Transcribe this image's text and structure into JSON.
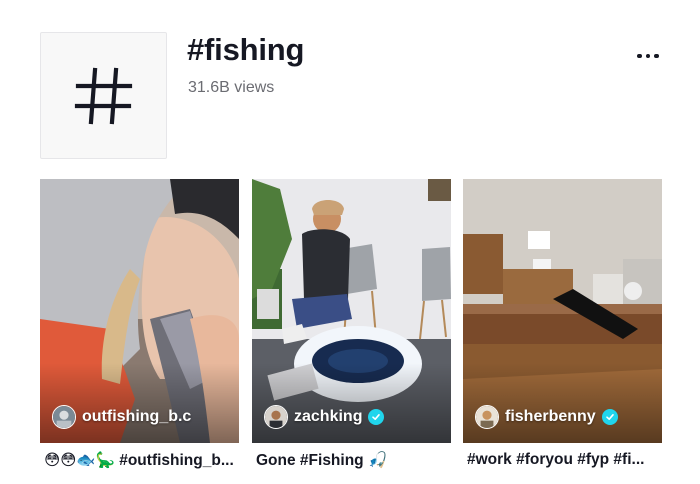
{
  "hashtag": {
    "icon": "hash-icon",
    "title": "#fishing",
    "views": "31.6B views",
    "more_icon": "more-dots-icon"
  },
  "videos": [
    {
      "author": "outfishing_b.c",
      "verified": false,
      "caption": "😳😳🐟🦕 #outfishing_b...",
      "thumbnail": "girl-in-hoodie-kissing-fishing-lure"
    },
    {
      "author": "zachking",
      "verified": true,
      "caption": "Gone #Fishing 🎣",
      "thumbnail": "man-ice-fishing-in-living-room"
    },
    {
      "author": "fisherbenny",
      "verified": true,
      "caption": "#work #foryou #fyp #fi...",
      "thumbnail": "kitchen-floor-kick"
    }
  ]
}
